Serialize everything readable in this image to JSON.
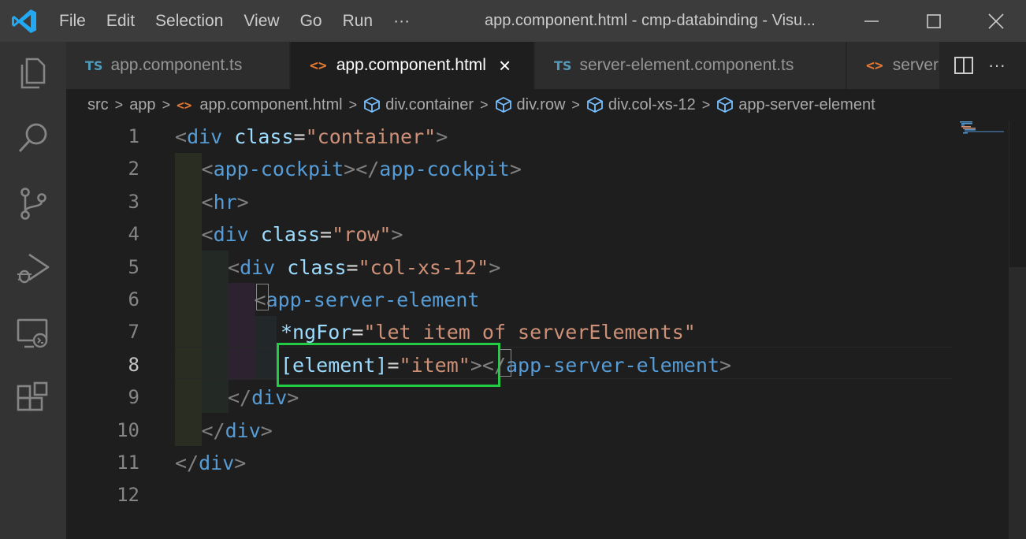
{
  "titlebar": {
    "menu": [
      "File",
      "Edit",
      "Selection",
      "View",
      "Go",
      "Run",
      "···"
    ],
    "title": "app.component.html - cmp-databinding - Visu...",
    "colors": {
      "bg": "#3c3c3c",
      "logo": "#23a9f2"
    }
  },
  "tabs": [
    {
      "badge": "TS",
      "label": "app.component.ts",
      "active": false
    },
    {
      "badge": "<>",
      "label": "app.component.html",
      "active": true,
      "close": "×"
    },
    {
      "badge": "TS",
      "label": "server-element.component.ts",
      "active": false
    },
    {
      "badge": "<>",
      "label": "server-",
      "active": false
    }
  ],
  "tab_actions": {
    "more": "···"
  },
  "breadcrumb": {
    "items": [
      "src",
      "app",
      "app.component.html",
      "div.container",
      "div.row",
      "div.col-xs-12",
      "app-server-element"
    ],
    "sep": ">"
  },
  "editor": {
    "line_numbers": [
      "1",
      "2",
      "3",
      "4",
      "5",
      "6",
      "7",
      "8",
      "9",
      "10",
      "11",
      "12"
    ],
    "current_line": "8",
    "lines": [
      [
        [
          "tg",
          "<"
        ],
        [
          "tn",
          "div"
        ],
        [
          "op",
          " "
        ],
        [
          "at",
          "class"
        ],
        [
          "op",
          "="
        ],
        [
          "av",
          "\"container\""
        ],
        [
          "tg",
          ">"
        ]
      ],
      [
        [
          "tg",
          "<"
        ],
        [
          "tn",
          "app-cockpit"
        ],
        [
          "tg",
          "></"
        ],
        [
          "tn",
          "app-cockpit"
        ],
        [
          "tg",
          ">"
        ]
      ],
      [
        [
          "tg",
          "<"
        ],
        [
          "tn",
          "hr"
        ],
        [
          "tg",
          ">"
        ]
      ],
      [
        [
          "tg",
          "<"
        ],
        [
          "tn",
          "div"
        ],
        [
          "op",
          " "
        ],
        [
          "at",
          "class"
        ],
        [
          "op",
          "="
        ],
        [
          "av",
          "\"row\""
        ],
        [
          "tg",
          ">"
        ]
      ],
      [
        [
          "tg",
          "<"
        ],
        [
          "tn",
          "div"
        ],
        [
          "op",
          " "
        ],
        [
          "at",
          "class"
        ],
        [
          "op",
          "="
        ],
        [
          "av",
          "\"col-xs-12\""
        ],
        [
          "tg",
          ">"
        ]
      ],
      [
        [
          "tg",
          "<"
        ],
        [
          "tn",
          "app-server-element"
        ]
      ],
      [
        [
          "at",
          "*ngFor"
        ],
        [
          "op",
          "="
        ],
        [
          "av",
          "\"let item of serverElements\""
        ]
      ],
      [
        [
          "at",
          "[element]"
        ],
        [
          "op",
          "="
        ],
        [
          "av",
          "\"item\""
        ],
        [
          "tg",
          "></"
        ],
        [
          "tn",
          "app-server-element"
        ],
        [
          "tg",
          ">"
        ]
      ],
      [
        [
          "tg",
          "</"
        ],
        [
          "tn",
          "div"
        ],
        [
          "tg",
          ">"
        ]
      ],
      [
        [
          "tg",
          "</"
        ],
        [
          "tn",
          "div"
        ],
        [
          "tg",
          ">"
        ]
      ],
      [
        [
          "tg",
          "</"
        ],
        [
          "tn",
          "div"
        ],
        [
          "tg",
          ">"
        ]
      ],
      []
    ],
    "highlight_color": "#22cc44"
  }
}
